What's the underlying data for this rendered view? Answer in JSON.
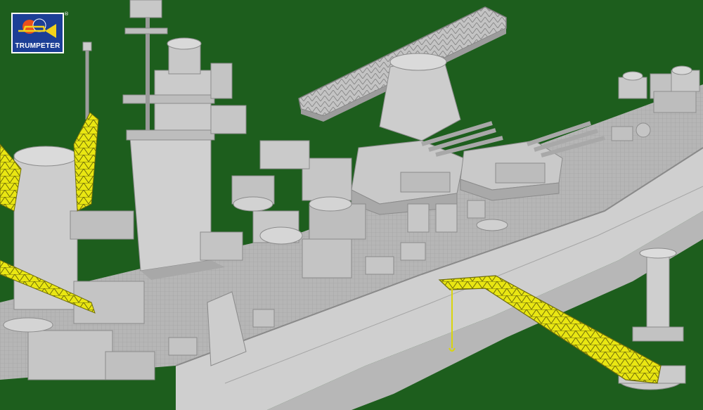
{
  "brand": {
    "name": "TRUMPETER",
    "registered_mark": "®"
  },
  "colors": {
    "background": "#1d5e1d",
    "hull": "#c9c9c9",
    "hull_shadow": "#9a9a9a",
    "deck": "#b4b4b4",
    "highlight": "#f2ee12",
    "logo_blue": "#1c3f96"
  }
}
